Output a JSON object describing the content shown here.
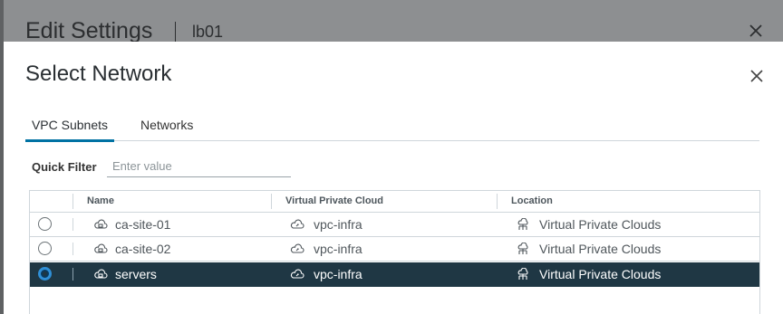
{
  "background_dialog": {
    "title": "Edit Settings",
    "subtitle": "lb01"
  },
  "modal": {
    "title": "Select Network",
    "tabs": [
      {
        "label": "VPC Subnets",
        "active": true
      },
      {
        "label": "Networks",
        "active": false
      }
    ],
    "filter": {
      "label": "Quick Filter",
      "placeholder": "Enter value",
      "value": ""
    },
    "grid": {
      "columns": [
        "Name",
        "Virtual Private Cloud",
        "Location"
      ],
      "rows": [
        {
          "name": "ca-site-01",
          "vpc": "vpc-infra",
          "location": "Virtual Private Clouds",
          "selected": false
        },
        {
          "name": "ca-site-02",
          "vpc": "vpc-infra",
          "location": "Virtual Private Clouds",
          "selected": false
        },
        {
          "name": "servers",
          "vpc": "vpc-infra",
          "location": "Virtual Private Clouds",
          "selected": true
        }
      ]
    }
  },
  "icons": {
    "close": "close-icon",
    "subnet": "subnet-icon",
    "vpc": "vpc-icon",
    "location": "vpc-folder-icon"
  },
  "colors": {
    "accent": "#0072a3",
    "selected_row": "#1f3744",
    "radio_selected": "#2f8fd6"
  }
}
